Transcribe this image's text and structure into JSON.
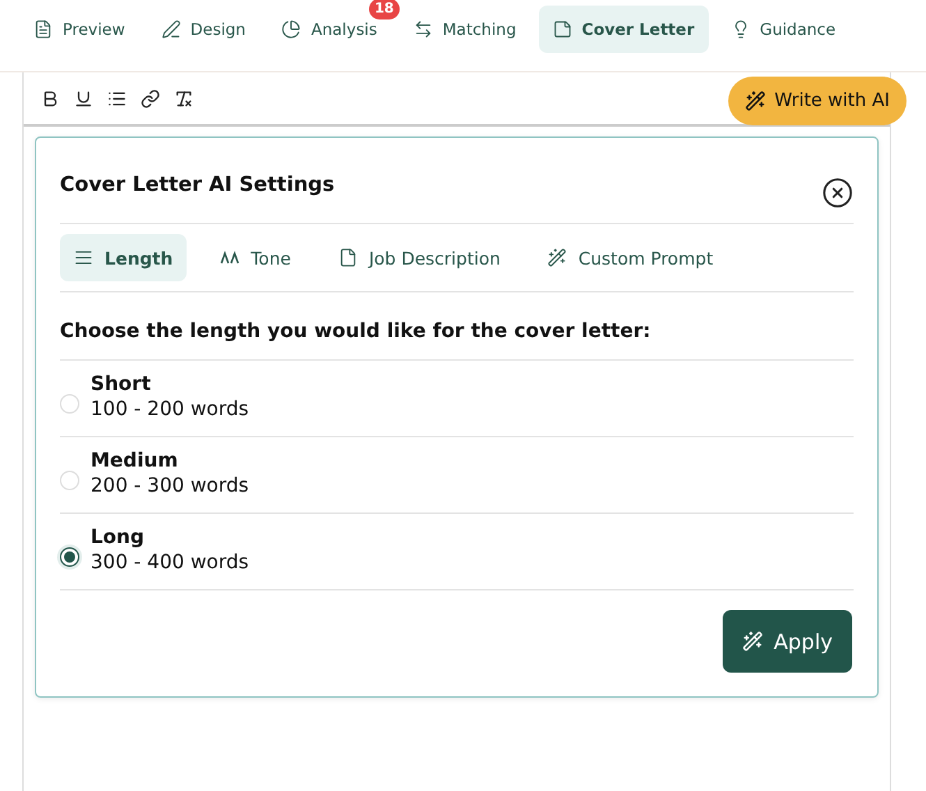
{
  "nav_tabs": [
    {
      "label": "Preview",
      "selected": false
    },
    {
      "label": "Design",
      "selected": false
    },
    {
      "label": "Analysis",
      "selected": false,
      "badge": "18"
    },
    {
      "label": "Matching",
      "selected": false
    },
    {
      "label": "Cover Letter",
      "selected": true
    },
    {
      "label": "Guidance",
      "selected": false
    }
  ],
  "toolbar": {
    "write_button": "Write with AI"
  },
  "settings": {
    "title": "Cover Letter AI Settings",
    "tabs": [
      {
        "label": "Length",
        "selected": true
      },
      {
        "label": "Tone",
        "selected": false
      },
      {
        "label": "Job Description",
        "selected": false
      },
      {
        "label": "Custom Prompt",
        "selected": false
      }
    ],
    "question": "Choose the length you would like for the cover letter:",
    "options": [
      {
        "title": "Short",
        "detail": "100 - 200 words",
        "selected": false
      },
      {
        "title": "Medium",
        "detail": "200 - 300 words",
        "selected": false
      },
      {
        "title": "Long",
        "detail": "300 - 400 words",
        "selected": true
      }
    ],
    "apply_button": "Apply"
  }
}
